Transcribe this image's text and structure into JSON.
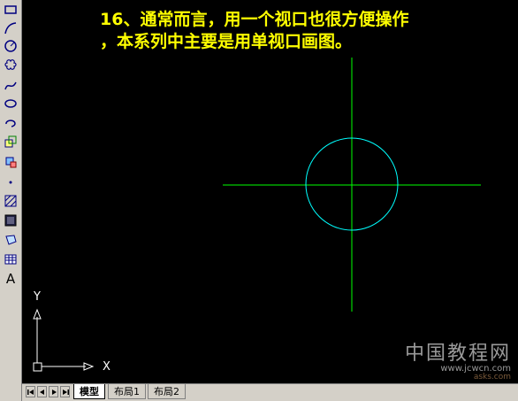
{
  "caption": {
    "line1": "16、通常而言，用一个视口也很方便操作",
    "line2": "，本系列中主要是用单视口画图。"
  },
  "colors": {
    "caption": "#ffff00",
    "crosshair": "#00ff00",
    "circle": "#00ffff",
    "background": "#000000"
  },
  "toolbar": {
    "tools": [
      "rectangle-icon",
      "arc-icon",
      "circle-icon",
      "revision-cloud-icon",
      "spline-icon",
      "ellipse-icon",
      "ellipse-arc-icon",
      "insert-block-icon",
      "make-block-icon",
      "point-icon",
      "hatch-icon",
      "gradient-icon",
      "region-icon",
      "table-icon",
      "multiline-text-icon"
    ],
    "text_tool_label": "A"
  },
  "ucs": {
    "x_label": "X",
    "y_label": "Y"
  },
  "tabs": {
    "items": [
      {
        "label": "模型",
        "active": true
      },
      {
        "label": "布局1",
        "active": false
      },
      {
        "label": "布局2",
        "active": false
      }
    ]
  },
  "watermark": {
    "line1": "中国教程网",
    "line2": "www.jcwcn.com",
    "line3": "asks.com"
  }
}
